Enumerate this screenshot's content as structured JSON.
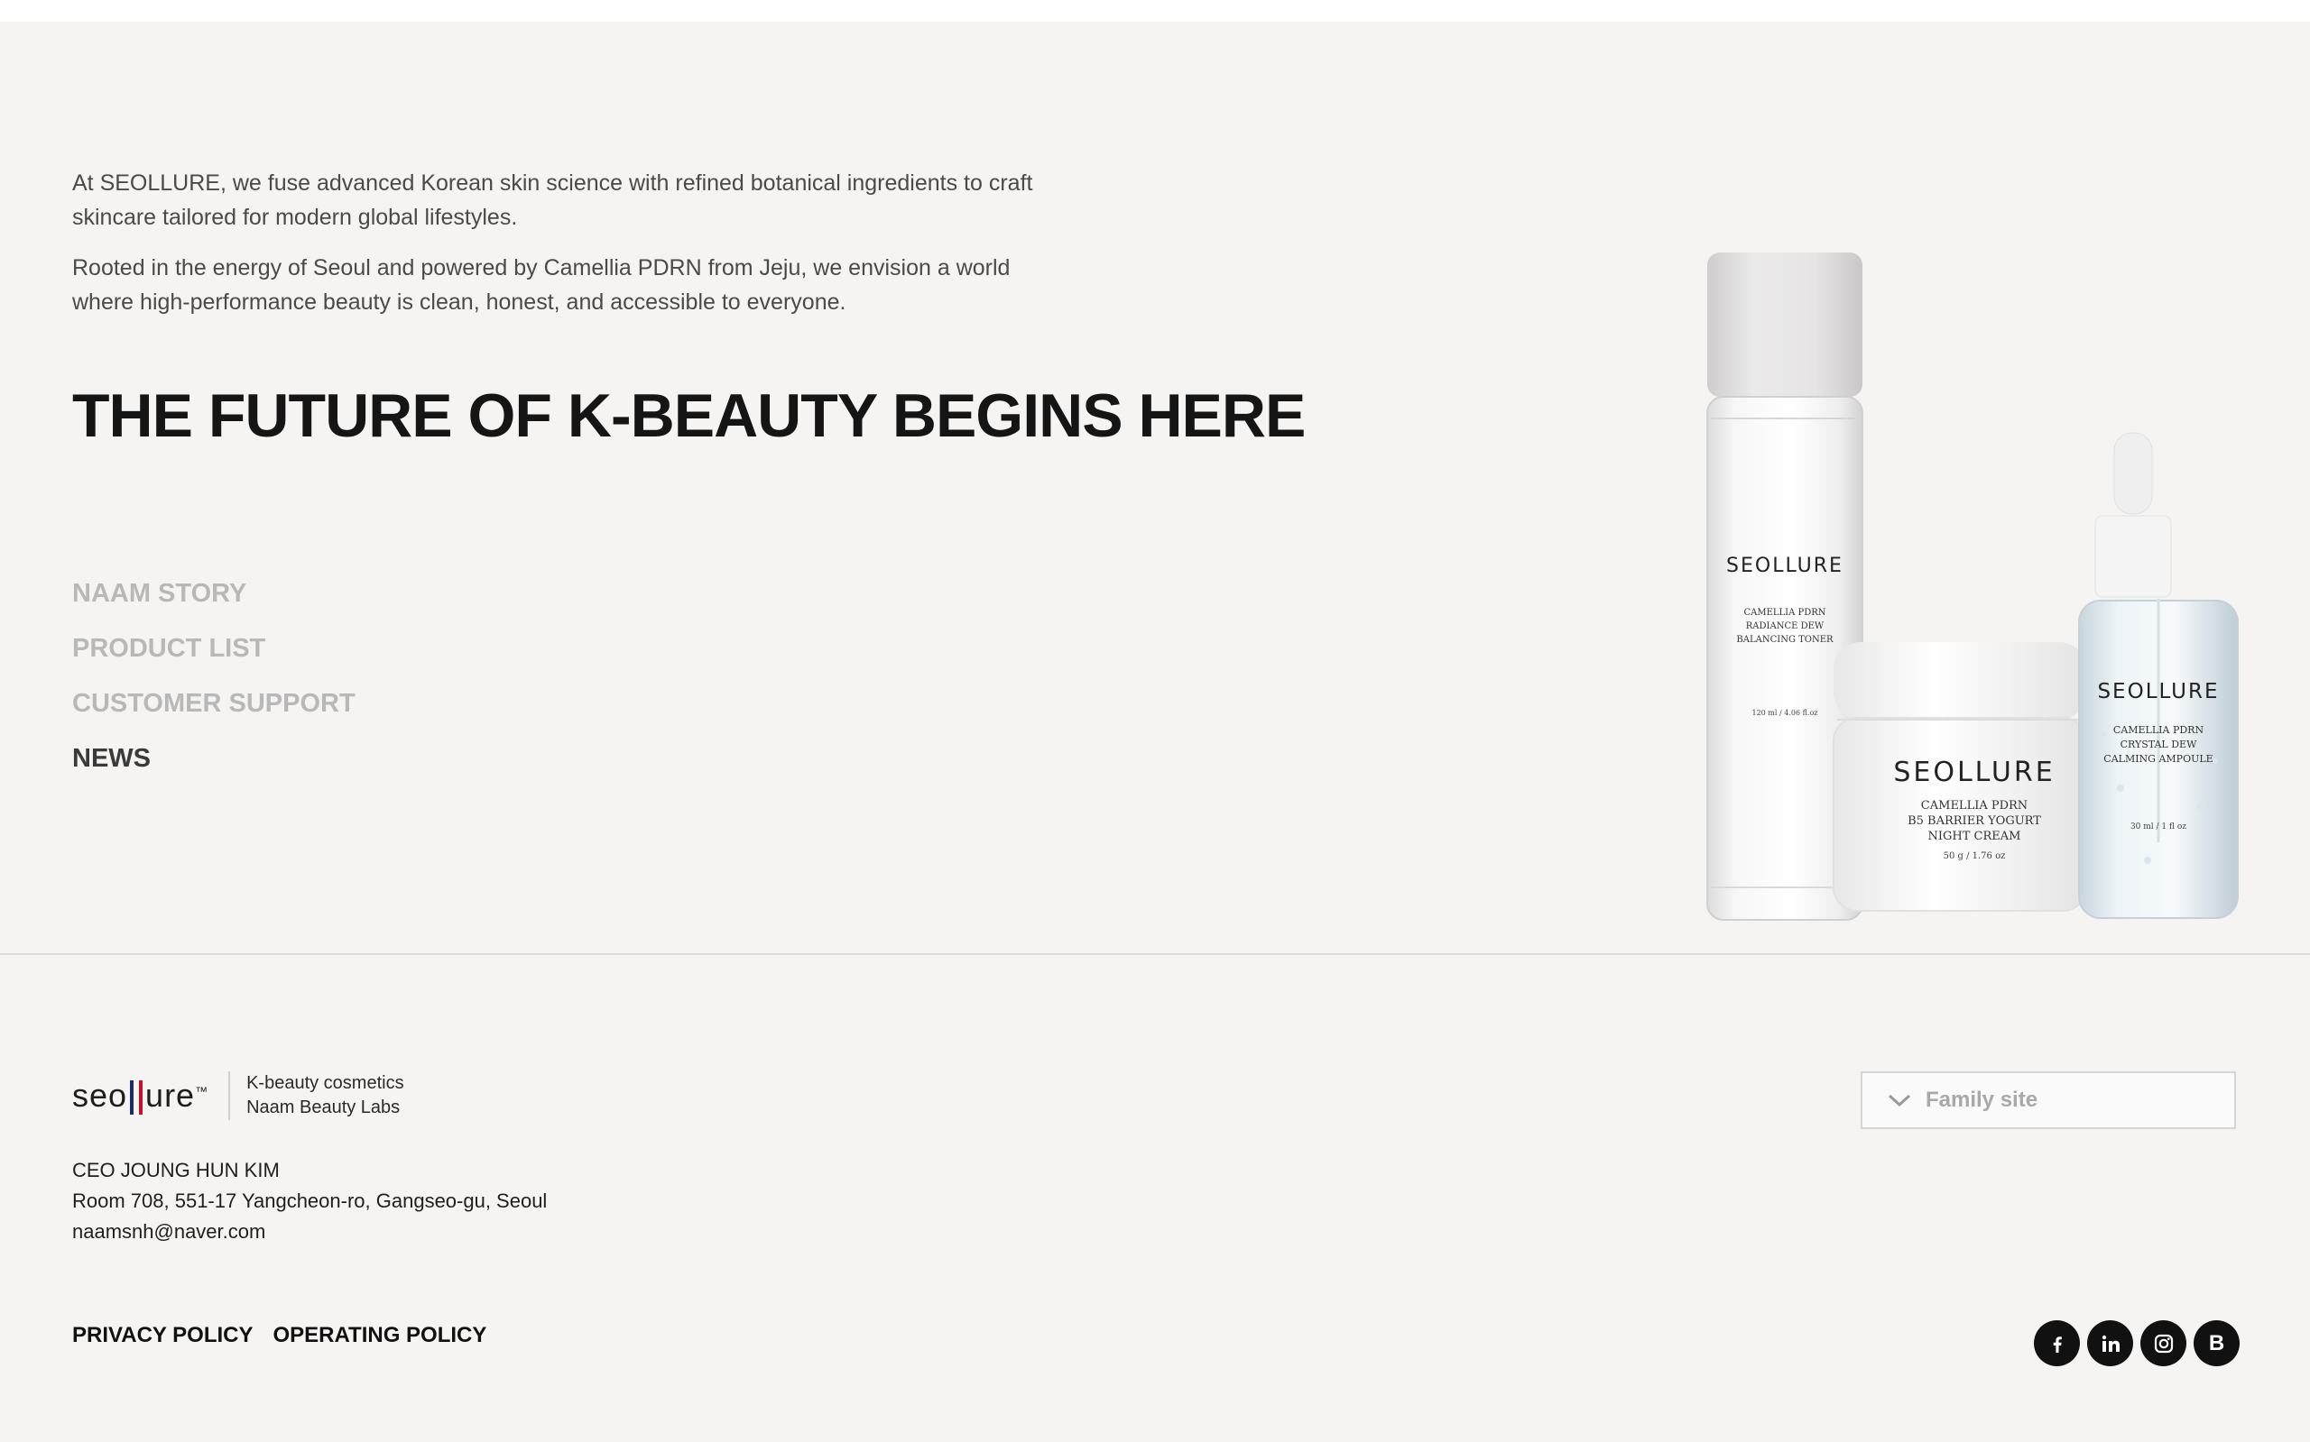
{
  "intro": {
    "p1": "At SEOLLURE, we fuse advanced Korean skin science with refined botanical ingredients to craft skincare tailored for modern global lifestyles.",
    "p2": "Rooted in the energy of Seoul and powered by Camellia PDRN from Jeju, we envision a world where high-performance beauty is clean, honest, and accessible to everyone."
  },
  "headline": "THE FUTURE OF K-BEAUTY BEGINS HERE",
  "nav": {
    "items": [
      {
        "label": "NAAM STORY"
      },
      {
        "label": "PRODUCT LIST"
      },
      {
        "label": "CUSTOMER SUPPORT"
      },
      {
        "label": "NEWS"
      }
    ],
    "active": "NEWS"
  },
  "products": {
    "toner": {
      "brand": "SEOLLURE",
      "line1": "CAMELLIA PDRN",
      "line2": "RADIANCE DEW",
      "line3": "BALANCING TONER",
      "volume": "120 ml / 4.06 fl.oz"
    },
    "cream": {
      "brand": "SEOLLURE",
      "line1": "CAMELLIA PDRN",
      "line2": "B5 BARRIER YOGURT",
      "line3": "NIGHT CREAM",
      "volume": "50 g / 1.76 oz"
    },
    "ampoule": {
      "brand": "SEOLLURE",
      "line1": "CAMELLIA PDRN",
      "line2": "CRYSTAL DEW",
      "line3": "CALMING AMPOULE",
      "volume": "30 ml / 1 fl oz"
    }
  },
  "footer": {
    "logo": {
      "word_left": "seo",
      "word_right": "ure",
      "tm": "™",
      "tagline1": "K-beauty cosmetics",
      "tagline2": "Naam Beauty Labs"
    },
    "ceo": "CEO JOUNG HUN KIM",
    "address": "Room 708, 551-17 Yangcheon-ro, Gangseo-gu, Seoul",
    "email": "naamsnh@naver.com",
    "policies": {
      "privacy": "PRIVACY POLICY",
      "operating": "OPERATING POLICY"
    },
    "family_site": "Family site",
    "social": [
      {
        "icon": "facebook-icon"
      },
      {
        "icon": "linkedin-icon"
      },
      {
        "icon": "instagram-icon"
      },
      {
        "icon": "blog-icon",
        "glyph": "B"
      }
    ]
  },
  "colors": {
    "background": "#f5f4f2",
    "logo_red": "#c8102e",
    "logo_navy": "#1f2a6b"
  }
}
